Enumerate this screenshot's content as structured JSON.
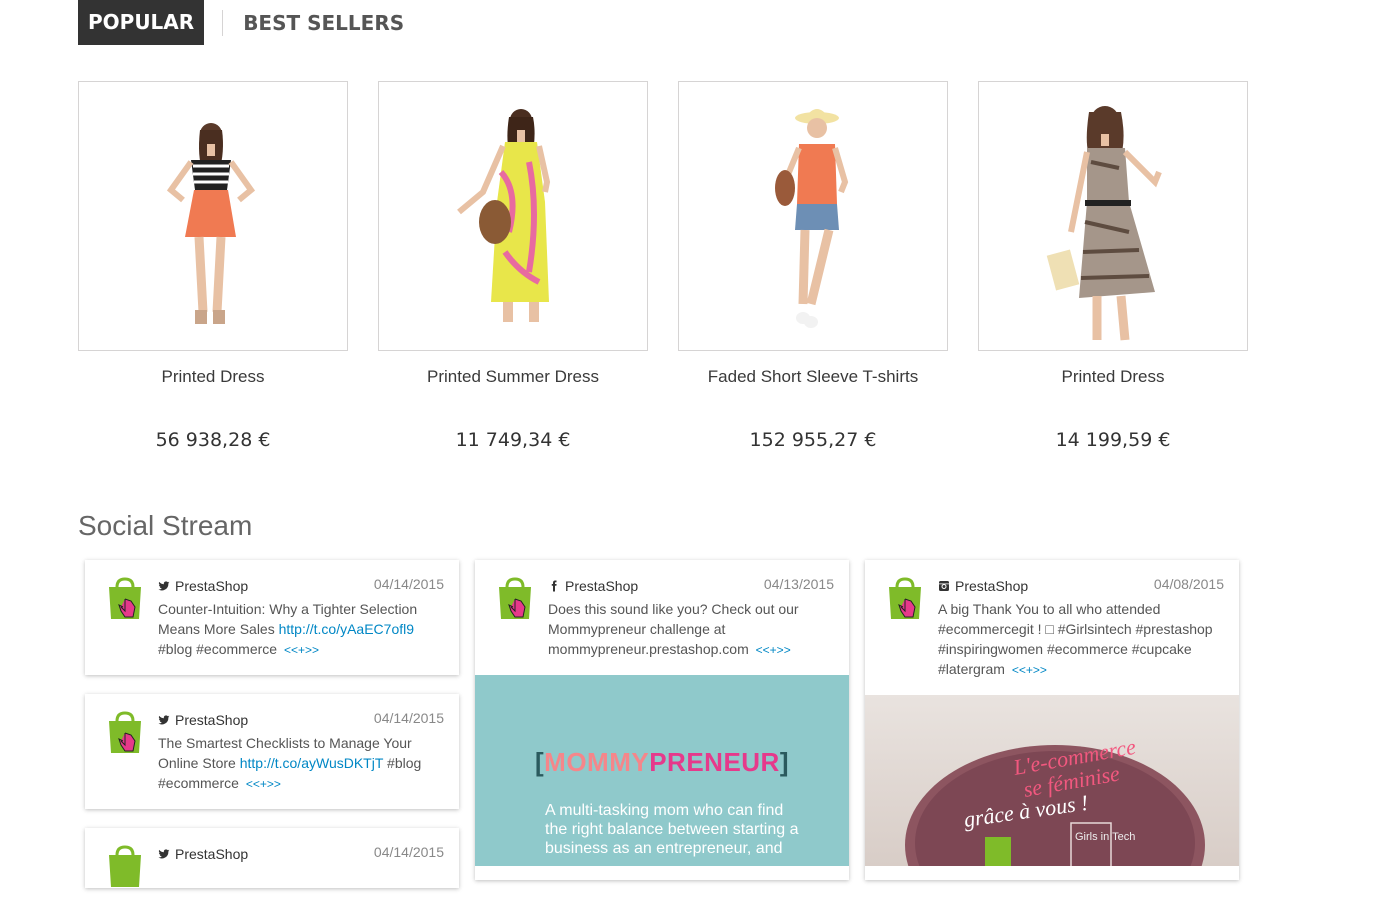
{
  "tabs": {
    "popular": "Popular",
    "best_sellers": "Best Sellers"
  },
  "products": [
    {
      "name": "Printed Dress",
      "price": "56 938,28 €"
    },
    {
      "name": "Printed Summer Dress",
      "price": "11 749,34 €"
    },
    {
      "name": "Faded Short Sleeve T-shirts",
      "price": "152 955,27 €"
    },
    {
      "name": "Printed Dress",
      "price": "14 199,59 €"
    }
  ],
  "social": {
    "title": "Social Stream",
    "more_label": "<<+>>",
    "posts": [
      {
        "network": "twitter",
        "author": "PrestaShop",
        "date": "04/14/2015",
        "text": "Counter-Intuition: Why a Tighter Selection Means More Sales",
        "link": "http://t.co/yAaEC7ofl9",
        "text_after": "#blog #ecommerce"
      },
      {
        "network": "twitter",
        "author": "PrestaShop",
        "date": "04/14/2015",
        "text": "The Smartest Checklists to Manage Your Online Store",
        "link": "http://t.co/ayWusDKTjT",
        "text_after": "#blog #ecommerce"
      },
      {
        "network": "twitter",
        "author": "PrestaShop",
        "date": "04/14/2015"
      },
      {
        "network": "facebook",
        "author": "PrestaShop",
        "date": "04/13/2015",
        "text": "Does this sound like you? Check out our Mommypreneur challenge at mommypreneur.prestashop.com"
      },
      {
        "network": "instagram",
        "author": "PrestaShop",
        "date": "04/08/2015",
        "text": "A big Thank You to all who attended #ecommercegit ! □ #Girlsintech #prestashop #inspiringwomen #ecommerce #cupcake #latergram"
      }
    ],
    "mommy": {
      "title_part1": "MOMMY",
      "title_part2": "PRENEUR",
      "text": "A multi-tasking mom who can find the right balance between starting a business as an entrepreneur, and"
    },
    "cake": {
      "line1": "L'e-commerce",
      "line2": "se féminise",
      "line3": "grâce à vous !",
      "brand": "Girls in Tech"
    }
  },
  "colors": {
    "tab_active_bg": "#333333",
    "link": "#0087c5",
    "logo_green": "#7fbb29",
    "logo_pink": "#e6398b",
    "mommy_bg": "#8fc9cb"
  }
}
